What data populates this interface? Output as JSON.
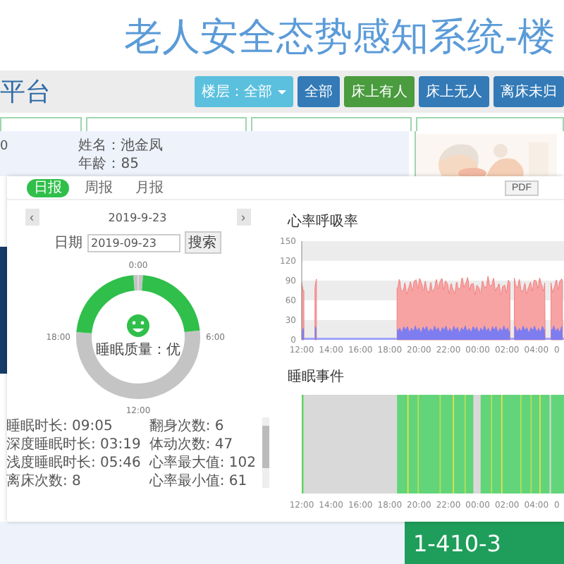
{
  "page_title": "老人安全态势感知系统-楼",
  "header": {
    "title": "平台",
    "floor_dropdown": "楼层：全部",
    "filters": [
      {
        "label": "全部",
        "selected": false
      },
      {
        "label": "床上有人",
        "selected": true
      },
      {
        "label": "床上无人",
        "selected": false
      },
      {
        "label": "离床未归",
        "selected": false
      }
    ]
  },
  "resident_card": {
    "bed_number": "0",
    "name": "姓名：池金凤",
    "age": "年龄：85"
  },
  "room_tile": {
    "label": "1-410-3"
  },
  "report_dialog": {
    "tabs": [
      {
        "label": "日报",
        "selected": true
      },
      {
        "label": "周报",
        "selected": false
      },
      {
        "label": "月报",
        "selected": false
      }
    ],
    "pdf_button": "PDF",
    "prev_button": "‹",
    "date_heading": "2019-9-23",
    "next_button": "›",
    "date_label": "日期",
    "date_value": "2019-09-23",
    "search_button": "搜索",
    "sleep_clock": {
      "hour_labels": [
        "0:00",
        "6:00",
        "12:00",
        "18:00"
      ],
      "quality": "睡眠质量：优"
    },
    "stats": [
      "睡眠时长: 09:05",
      "翻身次数: 6",
      "深度睡眠时长: 03:19",
      "体动次数: 47",
      "浅度睡眠时长: 05:46",
      "心率最大值: 102",
      "离床次数: 8",
      "心率最小值: 61"
    ],
    "heart_chart": {
      "title": "心率呼吸率",
      "y_ticks": [
        "150",
        "120",
        "90",
        "60",
        "30",
        "0"
      ],
      "x_ticks": [
        "12:00",
        "14:00",
        "16:00",
        "18:00",
        "20:00",
        "22:00",
        "00:00",
        "02:00",
        "04:00",
        "0"
      ]
    },
    "event_chart": {
      "title": "睡眠事件",
      "x_ticks": [
        "12:00",
        "14:00",
        "16:00",
        "18:00",
        "20:00",
        "22:00",
        "00:00",
        "02:00",
        "04:00",
        "0"
      ]
    }
  }
}
